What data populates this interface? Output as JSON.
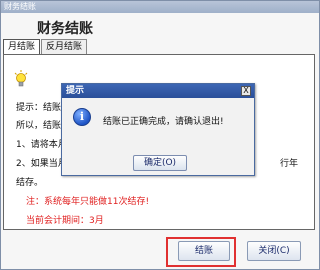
{
  "window": {
    "title": "财务结账",
    "header_title": "财务结账",
    "tabs": [
      {
        "label": "月结账",
        "active": true
      },
      {
        "label": "反月结账",
        "active": false
      }
    ]
  },
  "content": {
    "lines": [
      "提示：结账",
      "所以，结账",
      "1、请将本月",
      "2、如果当月",
      "结存。"
    ],
    "right_fragment": "行年",
    "warning": "注：系统每年只能做11次结存!",
    "current_period": "当前会计期间：3月"
  },
  "footer": {
    "close_label": "结账",
    "cancel_label": "关闭(C)"
  },
  "dialog": {
    "title": "提示",
    "close_symbol": "X",
    "icon": "info-icon",
    "message": "结账已正确完成，请确认退出!",
    "ok_label": "确定(O)"
  },
  "colors": {
    "highlight": "#e03030",
    "dialog_title_bg": "#2a4f99",
    "warning_text": "#e02020"
  }
}
